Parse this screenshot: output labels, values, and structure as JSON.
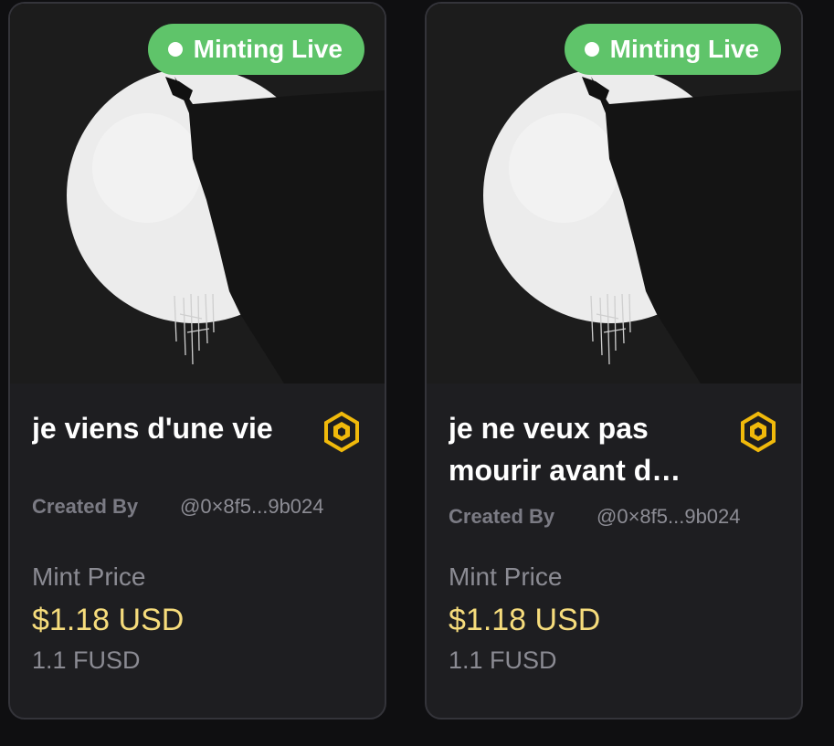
{
  "cards": [
    {
      "badge": "Minting Live",
      "title": "je viens d'une vie",
      "creator_label": "Created By",
      "creator": "@0×8f5...9b024",
      "price_label": "Mint Price",
      "price_usd": "$1.18 USD",
      "price_token": "1.1 FUSD",
      "chain_icon": "bnb-chain-icon"
    },
    {
      "badge": "Minting Live",
      "title": "je ne veux pas mourir avant d…",
      "creator_label": "Created By",
      "creator": "@0×8f5...9b024",
      "price_label": "Mint Price",
      "price_usd": "$1.18 USD",
      "price_token": "1.1 FUSD",
      "chain_icon": "bnb-chain-icon"
    }
  ],
  "colors": {
    "badge": "#5fc46a",
    "price": "#f6dc7c",
    "card": "#1e1e21",
    "chain_icon": "#f0b90b"
  }
}
